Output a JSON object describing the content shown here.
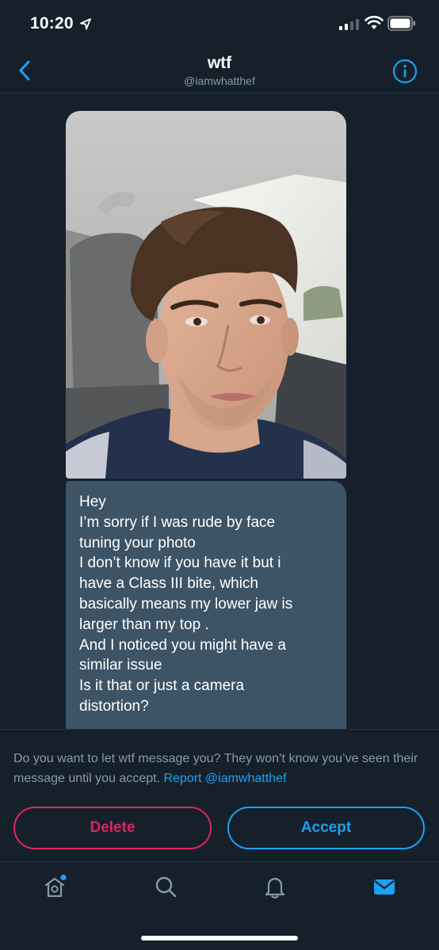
{
  "status_bar": {
    "time": "10:20"
  },
  "header": {
    "title": "wtf",
    "handle": "@iamwhatthef"
  },
  "conversation": {
    "photo_alt": "Selfie of a young man with wavy brown hair sitting in a car",
    "message_lines": [
      "Hey",
      "I’m sorry if I was rude by face",
      "tuning your photo",
      "I don’t know if you have it but i",
      "have a Class III bite, which",
      "basically means my lower jaw is",
      "larger than my top .",
      "And I noticed you might have a",
      "similar issue",
      "Is it that or just a camera",
      "distortion?"
    ]
  },
  "request": {
    "prompt": "Do you want to let wtf message you? They won’t know you’ve seen their message until you accept. ",
    "report_link": "Report @iamwhatthef",
    "delete_label": "Delete",
    "accept_label": "Accept"
  },
  "tabs": [
    {
      "icon": "home-icon",
      "active": false,
      "has_dot": true
    },
    {
      "icon": "search-icon",
      "active": false
    },
    {
      "icon": "notifications-icon",
      "active": false
    },
    {
      "icon": "messages-icon",
      "active": true
    }
  ],
  "colors": {
    "background": "#15202b",
    "bubble": "#3d5466",
    "accent": "#1da1f2",
    "danger": "#e0245e",
    "muted": "#8899a6"
  }
}
